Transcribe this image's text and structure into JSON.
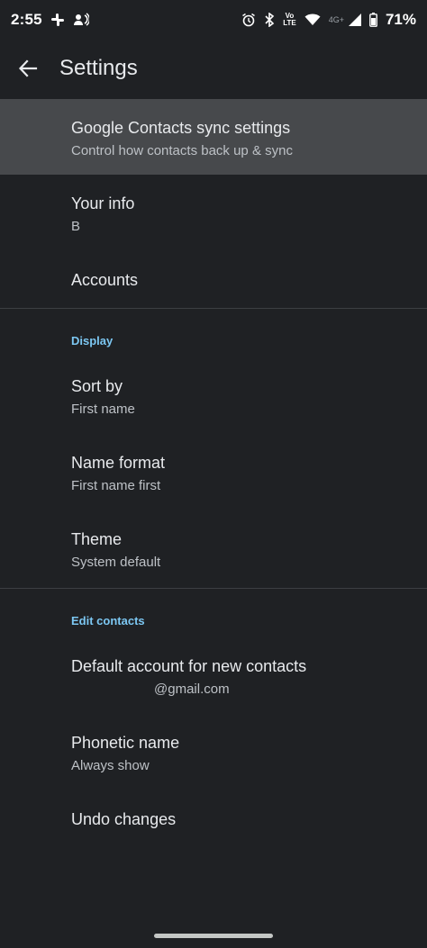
{
  "status_bar": {
    "time": "2:55",
    "volte_top": "Vo",
    "volte_bottom": "LTE",
    "network_label": "4G+",
    "battery_percent": "71%"
  },
  "app_bar": {
    "title": "Settings"
  },
  "items": {
    "sync": {
      "title": "Google Contacts sync settings",
      "subtitle": "Control how contacts back up & sync"
    },
    "your_info": {
      "title": "Your info",
      "subtitle": "B"
    },
    "accounts": {
      "title": "Accounts"
    },
    "sort_by": {
      "title": "Sort by",
      "subtitle": "First name"
    },
    "name_format": {
      "title": "Name format",
      "subtitle": "First name first"
    },
    "theme": {
      "title": "Theme",
      "subtitle": "System default"
    },
    "default_account": {
      "title": "Default account for new contacts",
      "subtitle": "@gmail.com"
    },
    "phonetic_name": {
      "title": "Phonetic name",
      "subtitle": "Always show"
    },
    "undo_changes": {
      "title": "Undo changes"
    }
  },
  "sections": {
    "display": "Display",
    "edit_contacts": "Edit contacts"
  },
  "colors": {
    "background": "#1f2124",
    "highlight": "#47494c",
    "accent": "#7cc7f2"
  }
}
